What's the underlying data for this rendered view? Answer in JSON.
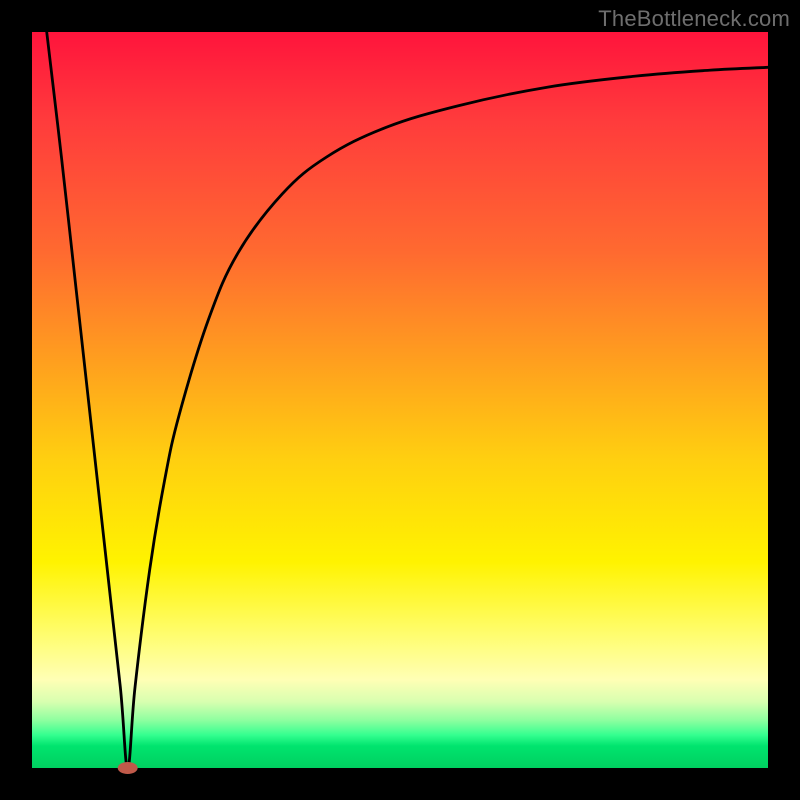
{
  "attribution": {
    "watermark": "TheBottleneck.com"
  },
  "chart_data": {
    "type": "line",
    "title": "",
    "xlabel": "",
    "ylabel": "",
    "xlim": [
      0,
      100
    ],
    "ylim": [
      0,
      100
    ],
    "grid": false,
    "legend": false,
    "background_gradient": {
      "stops": [
        {
          "pos": 0.0,
          "color": "#ff143c"
        },
        {
          "pos": 0.12,
          "color": "#ff3b3c"
        },
        {
          "pos": 0.3,
          "color": "#ff6a30"
        },
        {
          "pos": 0.45,
          "color": "#ffa01e"
        },
        {
          "pos": 0.58,
          "color": "#ffcf10"
        },
        {
          "pos": 0.72,
          "color": "#fff300"
        },
        {
          "pos": 0.82,
          "color": "#fffd70"
        },
        {
          "pos": 0.88,
          "color": "#ffffb5"
        },
        {
          "pos": 0.91,
          "color": "#d8ffb0"
        },
        {
          "pos": 0.935,
          "color": "#8effa0"
        },
        {
          "pos": 0.955,
          "color": "#35ff90"
        },
        {
          "pos": 0.97,
          "color": "#00e46e"
        },
        {
          "pos": 1.0,
          "color": "#00d060"
        }
      ]
    },
    "min_marker": {
      "x": 13,
      "y": 0,
      "color": "#c05a4a"
    },
    "series": [
      {
        "name": "curve",
        "x": [
          2,
          4,
          6,
          8,
          10,
          12,
          13,
          14,
          16,
          18,
          20,
          24,
          28,
          34,
          40,
          48,
          58,
          70,
          82,
          92,
          100
        ],
        "y": [
          100,
          83,
          65,
          47,
          29,
          11,
          0,
          11,
          27,
          39,
          48,
          61,
          70,
          78,
          83,
          87,
          90,
          92.5,
          94,
          94.8,
          95.2
        ]
      }
    ]
  }
}
